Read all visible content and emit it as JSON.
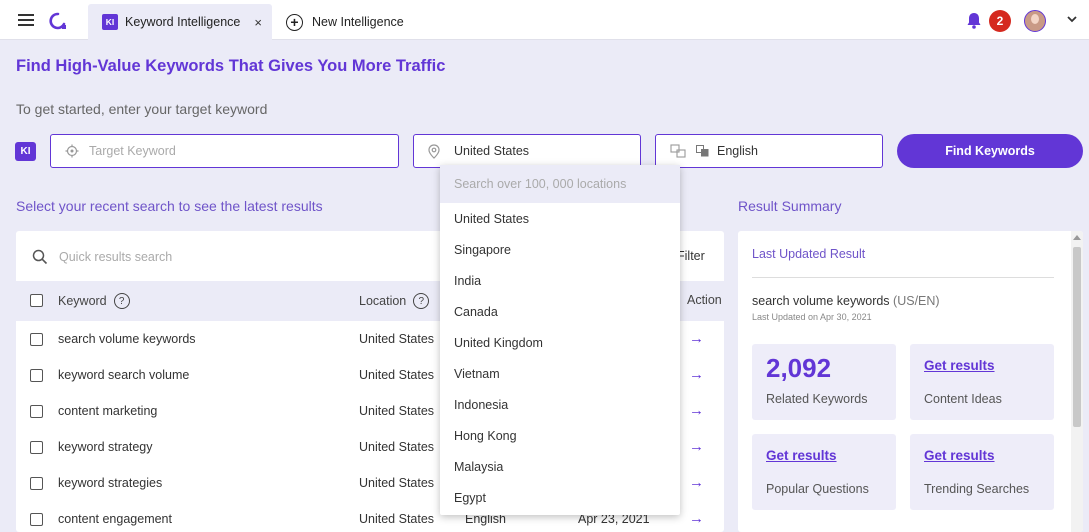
{
  "tabs": [
    {
      "badge": "KI",
      "label": "Keyword Intelligence",
      "close": "×"
    },
    {
      "label": "New Intelligence"
    }
  ],
  "header": {
    "notification_count": "2"
  },
  "hero": {
    "title": "Find High-Value Keywords That Gives You More Traffic",
    "subtitle": "To get started, enter your target keyword"
  },
  "search": {
    "badge": "KI",
    "keyword_placeholder": "Target Keyword",
    "location": "United States",
    "language": "English",
    "button": "Find Keywords"
  },
  "recent": {
    "title": "Select your recent search to see the latest results",
    "quick_search_placeholder": "Quick results search",
    "filter_label": "Filter",
    "columns": {
      "keyword": "Keyword",
      "location": "Location",
      "action": "Action"
    },
    "rows": [
      {
        "keyword": "search volume keywords",
        "location": "United States",
        "language": "",
        "date": ""
      },
      {
        "keyword": "keyword search volume",
        "location": "United States",
        "language": "",
        "date": ""
      },
      {
        "keyword": "content marketing",
        "location": "United States",
        "language": "",
        "date": ""
      },
      {
        "keyword": "keyword strategy",
        "location": "United States",
        "language": "",
        "date": ""
      },
      {
        "keyword": "keyword strategies",
        "location": "United States",
        "language": "",
        "date": ""
      },
      {
        "keyword": "content engagement",
        "location": "United States",
        "language": "English",
        "date": "Apr 23, 2021"
      }
    ]
  },
  "location_dropdown": {
    "search_placeholder": "Search over 100, 000 locations",
    "options": [
      "United States",
      "Singapore",
      "India",
      "Canada",
      "United Kingdom",
      "Vietnam",
      "Indonesia",
      "Hong Kong",
      "Malaysia",
      "Egypt"
    ]
  },
  "summary": {
    "title": "Result Summary",
    "last_updated_title": "Last Updated Result",
    "keyword": "search volume keywords",
    "locale": "(US/EN)",
    "updated": "Last Updated on Apr 30, 2021",
    "tiles": [
      {
        "value": "2,092",
        "label": "Related Keywords"
      },
      {
        "link": "Get results",
        "label": "Content Ideas"
      },
      {
        "link": "Get results",
        "label": "Popular Questions"
      },
      {
        "link": "Get results",
        "label": "Trending Searches"
      }
    ]
  },
  "colors": {
    "accent": "#6236d6",
    "background": "#ebebf7",
    "notification": "#d5291f"
  }
}
